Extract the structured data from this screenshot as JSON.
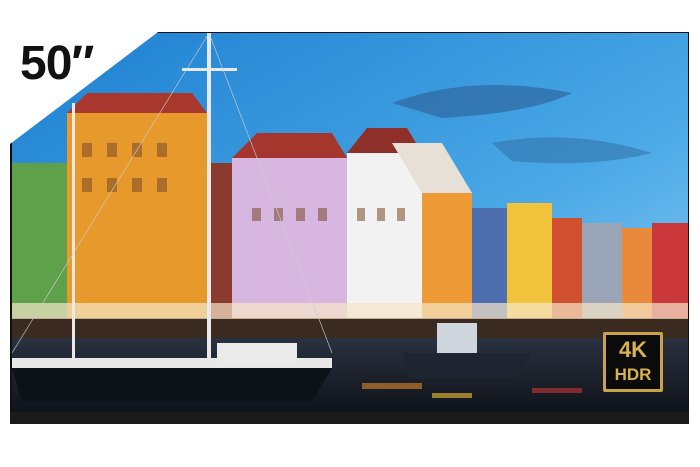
{
  "product": {
    "size_label": "50″",
    "badge_top": "4K",
    "badge_bottom": "HDR"
  },
  "colors": {
    "badge_gold": "#caa24a",
    "sky": "#3a8fd6",
    "water": "#1b2430"
  }
}
